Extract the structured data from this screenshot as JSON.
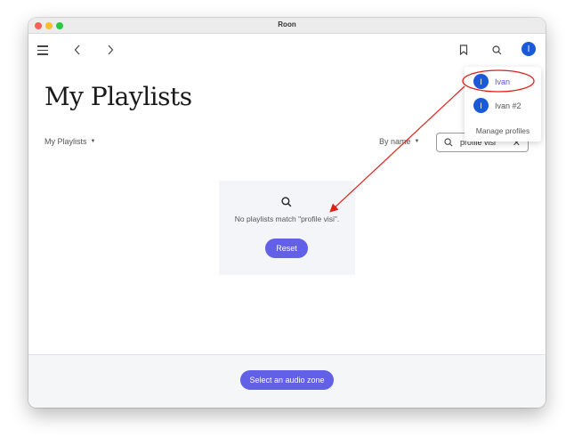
{
  "window": {
    "title": "Roon"
  },
  "toolbar": {
    "menu_icon": "hamburger-icon",
    "back_icon": "chevron-left-icon",
    "forward_icon": "chevron-right-icon",
    "bookmark_icon": "bookmark-icon",
    "search_icon": "search-icon",
    "avatar_initial": "I"
  },
  "page": {
    "title": "My Playlists",
    "filter_label": "My Playlists",
    "sort_label": "By name",
    "search": {
      "value": "profile visi",
      "clear_icon": "close-icon"
    }
  },
  "empty_state": {
    "icon": "search-icon",
    "message": "No playlists match \"profile visi\".",
    "reset_label": "Reset"
  },
  "footer": {
    "zone_button_label": "Select an audio zone"
  },
  "profile_menu": {
    "items": [
      {
        "initial": "I",
        "label": "Ivan",
        "active": true
      },
      {
        "initial": "I",
        "label": "Ivan #2",
        "active": false
      }
    ],
    "manage_label": "Manage profiles"
  },
  "colors": {
    "accent": "#6260e6",
    "avatar": "#1a5ad8",
    "annotation": "#e0201a"
  }
}
